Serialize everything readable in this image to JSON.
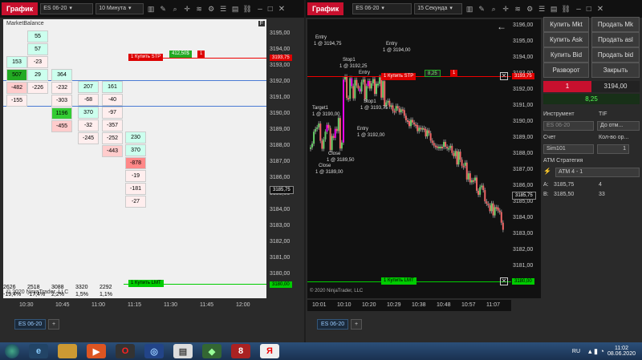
{
  "chart1": {
    "logo": "График",
    "instrument": "ES 06-20",
    "interval": "10 Минута",
    "indicator": "MarketBalance",
    "prices": [
      "3195,00",
      "3194,00",
      "3193,00",
      "3192,00",
      "3191,00",
      "3190,00",
      "3189,00",
      "3188,00",
      "3187,00",
      "3186,00",
      "3185,00",
      "3184,00",
      "3183,00",
      "3182,00",
      "3181,00",
      "3180,00"
    ],
    "times": [
      "10:30",
      "10:45",
      "11:00",
      "11:15",
      "11:30",
      "11:45",
      "12:00"
    ],
    "stop_label": "1  Купить STP",
    "stop_pnl": "412,50$",
    "stop_qty": "1",
    "stop_price": "3193,75",
    "current_price": "3185,75",
    "lmt_label": "1  Купить LMT",
    "lmt_price": "3180,00",
    "copyright": "© 2020 NinjaTrader, LLC",
    "summary": [
      "2626",
      "2518",
      "3088",
      "3320",
      "2292"
    ],
    "pct": [
      "-19,4%",
      "-17,4%",
      "2,2%",
      "1,5%",
      "1,1%"
    ],
    "tab": "ES 06-20",
    "add_tab": "+",
    "cols": [
      [
        {
          "v": "55"
        },
        {
          "v": "57"
        },
        {
          "v": "-23"
        },
        {
          "v": "29"
        },
        {
          "v": "-226"
        }
      ],
      [
        {
          "v": "153"
        },
        {
          "v": "507"
        },
        {
          "v": "-482"
        },
        {
          "v": "-155"
        }
      ],
      [
        {
          "v": "364"
        },
        {
          "v": "-232"
        },
        {
          "v": "-303"
        },
        {
          "v": "1196"
        },
        {
          "v": "-455"
        }
      ],
      [
        {
          "v": "207"
        },
        {
          "v": "-68"
        },
        {
          "v": "370"
        },
        {
          "v": "-32"
        },
        {
          "v": "-245"
        }
      ],
      [
        {
          "v": "161"
        },
        {
          "v": "-40"
        },
        {
          "v": "-97"
        },
        {
          "v": "-357"
        },
        {
          "v": "-252"
        },
        {
          "v": "-443"
        }
      ],
      [
        {
          "v": "230"
        },
        {
          "v": "370"
        },
        {
          "v": "-878"
        },
        {
          "v": "-19"
        },
        {
          "v": "-181"
        },
        {
          "v": "-27"
        }
      ]
    ]
  },
  "chart2": {
    "logo": "График",
    "instrument": "ES 06-20",
    "interval": "15 Секунда",
    "prices": [
      "3196,00",
      "3195,00",
      "3194,00",
      "3193,00",
      "3192,00",
      "3191,00",
      "3190,00",
      "3189,00",
      "3188,00",
      "3187,00",
      "3186,00",
      "3185,00",
      "3184,00",
      "3183,00",
      "3182,00",
      "3181,00",
      "3180,00"
    ],
    "times": [
      "10:01",
      "10:10",
      "10:20",
      "10:29",
      "10:38",
      "10:48",
      "10:57",
      "11:07"
    ],
    "stop_label": "1  Купить STP",
    "stop_pnl": "8,25",
    "stop_qty": "1",
    "stop_price": "3193,75",
    "current_price": "3185,75",
    "lmt_label": "1  Купить LMT",
    "lmt_price": "3180,00",
    "copyright": "© 2020 NinjaTrader, LLC",
    "annotations": [
      "Entry",
      "1 @ 3194,75",
      "Stop1",
      "1 @ 3192,25",
      "Entry",
      "1 @ 3194,00",
      "Entry",
      "Target1",
      "1 @ 3190,00",
      "Stop1",
      "1 @ 3193,75",
      "Entry",
      "1 @ 3192,00",
      "Close",
      "1 @ 3189,50",
      "Close",
      "1 @ 3189,00"
    ],
    "tab": "ES 06-20",
    "add_tab": "+"
  },
  "panel": {
    "buy_mkt": "Купить Mkt",
    "sell_mkt": "Продать Mk",
    "buy_ask": "Купить Ask",
    "sell_ask": "Продать asl",
    "buy_bid": "Купить Bid",
    "sell_bid": "Продать bid",
    "reverse": "Разворот",
    "close": "Закрыть",
    "pos_qty": "1",
    "pos_price": "3194,00",
    "pnl": "8,25",
    "instrument_lbl": "Инструмент",
    "instrument_val": "ES 06-20",
    "tif_lbl": "TIF",
    "tif_val": "До отм...",
    "account_lbl": "Счет",
    "account_val": "Sim101",
    "qty_lbl": "Кол-во ор...",
    "qty_val": "1",
    "atm_lbl": "АТМ Стратегия",
    "atm_val": "АТМ 4 - 1",
    "a_lbl": "A:",
    "a_price": "3185,75",
    "a_qty": "4",
    "b_lbl": "B:",
    "b_price": "3185,50",
    "b_qty": "33"
  },
  "taskbar": {
    "lang": "RU",
    "time": "11:02",
    "date": "08.06.2020"
  }
}
